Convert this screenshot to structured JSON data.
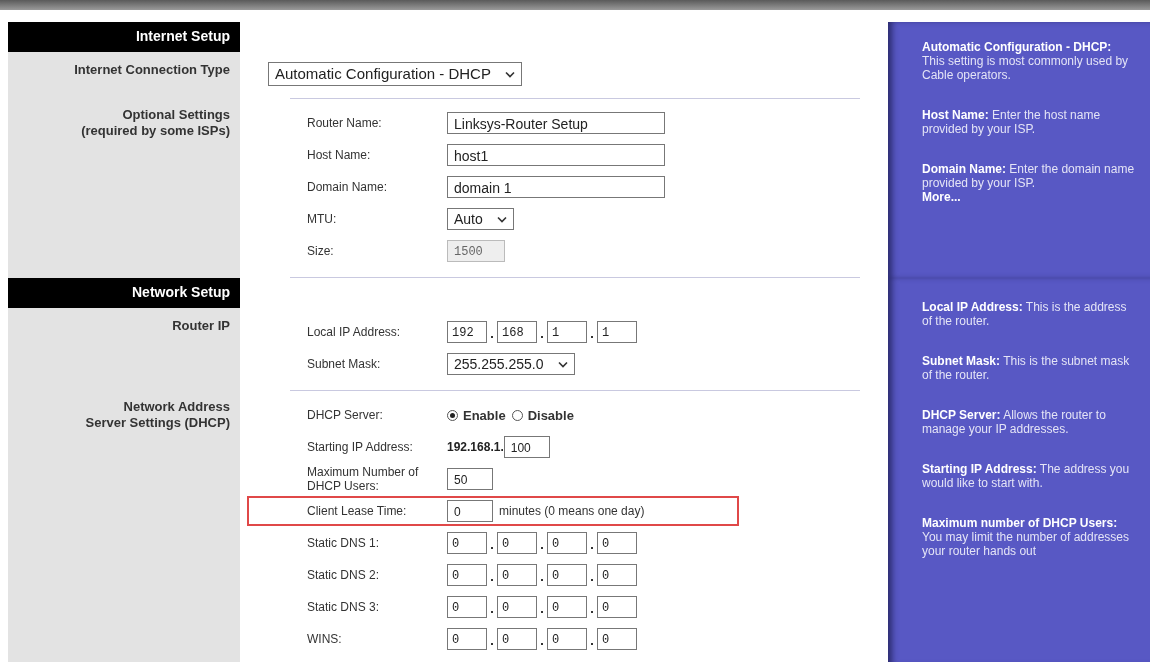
{
  "sections": [
    {
      "title": "Internet Setup",
      "groups": [
        {
          "label": "Internet Connection Type",
          "rows": [
            {
              "kind": "select",
              "value": "Automatic Configuration - DHCP",
              "highlighted": false
            }
          ]
        },
        {
          "label": "Optional Settings",
          "sublabel": "(required by some ISPs)",
          "rows": [
            {
              "kind": "text",
              "label": "Router Name:",
              "value": "Linksys-Router Setup",
              "disabled": false,
              "highlighted": false
            },
            {
              "kind": "text",
              "label": "Host Name:",
              "value": "host1",
              "disabled": false,
              "highlighted": false
            },
            {
              "kind": "text",
              "label": "Domain Name:",
              "value": "domain 1",
              "disabled": false,
              "highlighted": false
            },
            {
              "kind": "select",
              "label": "MTU:",
              "value": "Auto",
              "highlighted": false
            },
            {
              "kind": "short-text",
              "label": "Size:",
              "value": "1500",
              "disabled": true,
              "highlighted": false
            }
          ]
        }
      ],
      "help": [
        {
          "text": "**Automatic Configuration - DHCP:** This setting is most commonly used by Cable operators."
        },
        {
          "text": "**Host Name:** Enter the host name provided by your ISP."
        },
        {
          "text": "**Domain Name:** Enter the domain name provided by your ISP.",
          "link": "More..."
        }
      ]
    },
    {
      "title": "Network Setup",
      "groups": [
        {
          "label": "Router IP",
          "rows": [
            {
              "kind": "ip",
              "label": "Local IP Address:",
              "octets": [
                "192",
                "168",
                "1",
                "1"
              ],
              "highlighted": false
            },
            {
              "kind": "select",
              "label": "Subnet Mask:",
              "value": "255.255.255.0",
              "highlighted": false
            }
          ]
        },
        {
          "label": "Network Address",
          "sublabel": "Server Settings (DHCP)",
          "rows": [
            {
              "kind": "radio",
              "label": "DHCP Server:",
              "options": [
                {
                  "label": "Enable",
                  "selected": true
                },
                {
                  "label": "Disable",
                  "selected": false
                }
              ],
              "highlighted": false
            },
            {
              "kind": "prefixed",
              "label": "Starting IP Address:",
              "prefix": "192.168.1.",
              "value": "100",
              "highlighted": false
            },
            {
              "kind": "short-text",
              "label": "Maximum Number of DHCP Users:",
              "value": "50",
              "disabled": false,
              "highlighted": false
            },
            {
              "kind": "suffixed",
              "label": "Client Lease Time:",
              "value": "0",
              "suffix": "minutes (0 means one day)",
              "highlighted": true
            },
            {
              "kind": "ip",
              "label": "Static DNS 1:",
              "octets": [
                "0",
                "0",
                "0",
                "0"
              ],
              "highlighted": false
            },
            {
              "kind": "ip",
              "label": "Static DNS 2:",
              "octets": [
                "0",
                "0",
                "0",
                "0"
              ],
              "highlighted": false
            },
            {
              "kind": "ip",
              "label": "Static DNS 3:",
              "octets": [
                "0",
                "0",
                "0",
                "0"
              ],
              "highlighted": false
            },
            {
              "kind": "ip",
              "label": "WINS:",
              "octets": [
                "0",
                "0",
                "0",
                "0"
              ],
              "highlighted": false
            }
          ]
        }
      ],
      "help": [
        {
          "text": "**Local IP Address:** This is the address of the router."
        },
        {
          "text": "**Subnet Mask:** This is the subnet mask of the router."
        },
        {
          "text": "**DHCP Server:** Allows the router to manage your IP addresses."
        },
        {
          "text": "**Starting IP Address:** The address you would like to start with."
        },
        {
          "text": "**Maximum number of DHCP Users:** You may limit the number of addresses your router hands out"
        }
      ]
    }
  ]
}
